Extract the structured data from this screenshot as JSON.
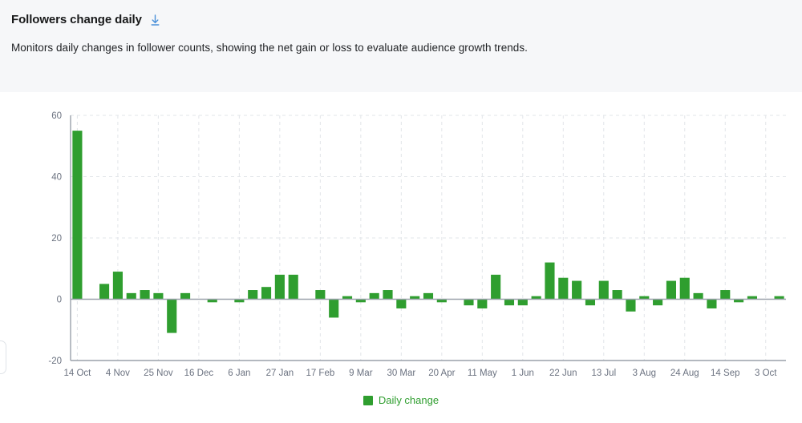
{
  "header": {
    "title": "Followers change daily",
    "download_icon": "download-icon",
    "subtitle": "Monitors daily changes in follower counts, showing the net gain or loss to evaluate audience growth trends."
  },
  "colors": {
    "bar": "#2f9e2f",
    "legend_text": "#2f9e2f",
    "header_bg": "#f6f7f9",
    "axis": "#9aa1aa",
    "grid": "#e2e5e9",
    "tick_text": "#6b7280",
    "download_icon": "#4a90d9"
  },
  "legend": {
    "items": [
      {
        "label": "Daily change",
        "color": "#2f9e2f"
      }
    ]
  },
  "chart_data": {
    "type": "bar",
    "title": "Followers change daily",
    "xlabel": "",
    "ylabel": "",
    "ylim": [
      -20,
      60
    ],
    "yticks": [
      -20,
      0,
      20,
      40,
      60
    ],
    "grid": true,
    "legend_position": "bottom",
    "series": [
      {
        "name": "Daily change",
        "color": "#2f9e2f",
        "values": [
          55,
          0,
          5,
          9,
          2,
          3,
          2,
          -11,
          2,
          0,
          -1,
          0,
          -1,
          3,
          4,
          8,
          8,
          0,
          3,
          -6,
          1,
          -1,
          2,
          3,
          -3,
          1,
          2,
          -1,
          0,
          -2,
          -3,
          8,
          -2,
          -2,
          1,
          12,
          7,
          6,
          -2,
          6,
          3,
          -4,
          1,
          -2,
          6,
          7,
          2,
          -3,
          3,
          -1,
          1,
          0,
          1
        ]
      }
    ],
    "categories": [
      "14 Oct",
      "",
      "",
      "4 Nov",
      "",
      "",
      "25 Nov",
      "",
      "",
      "16 Dec",
      "",
      "",
      "6 Jan",
      "",
      "",
      "27 Jan",
      "",
      "",
      "17 Feb",
      "",
      "",
      "9 Mar",
      "",
      "",
      "30 Mar",
      "",
      "",
      "20 Apr",
      "",
      "",
      "11 May",
      "",
      "",
      "1 Jun",
      "",
      "",
      "22 Jun",
      "",
      "",
      "13 Jul",
      "",
      "",
      "3 Aug",
      "",
      "",
      "24 Aug",
      "",
      "",
      "14 Sep",
      "",
      "",
      "3 Oct",
      ""
    ],
    "xticks": [
      {
        "index": 0,
        "label": "14 Oct"
      },
      {
        "index": 3,
        "label": "4 Nov"
      },
      {
        "index": 6,
        "label": "25 Nov"
      },
      {
        "index": 9,
        "label": "16 Dec"
      },
      {
        "index": 12,
        "label": "6 Jan"
      },
      {
        "index": 15,
        "label": "27 Jan"
      },
      {
        "index": 18,
        "label": "17 Feb"
      },
      {
        "index": 21,
        "label": "9 Mar"
      },
      {
        "index": 24,
        "label": "30 Mar"
      },
      {
        "index": 27,
        "label": "20 Apr"
      },
      {
        "index": 30,
        "label": "11 May"
      },
      {
        "index": 33,
        "label": "1 Jun"
      },
      {
        "index": 36,
        "label": "22 Jun"
      },
      {
        "index": 39,
        "label": "13 Jul"
      },
      {
        "index": 42,
        "label": "3 Aug"
      },
      {
        "index": 45,
        "label": "24 Aug"
      },
      {
        "index": 48,
        "label": "14 Sep"
      },
      {
        "index": 51,
        "label": "3 Oct"
      }
    ]
  }
}
